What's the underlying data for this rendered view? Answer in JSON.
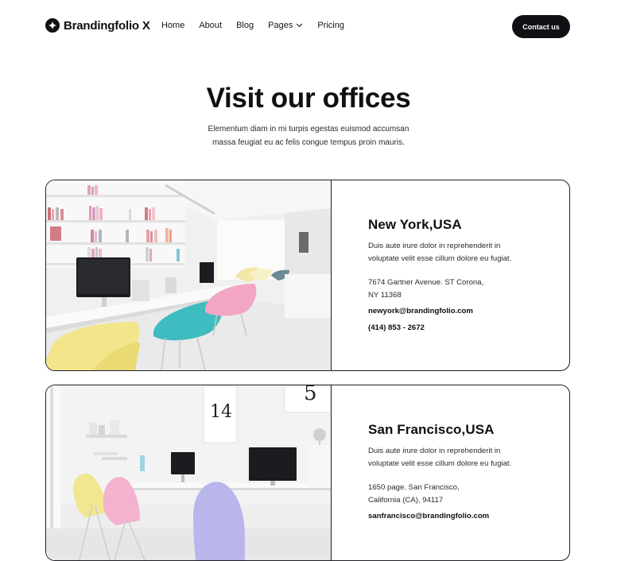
{
  "brand": {
    "name": "Brandingfolio X",
    "icon": "sparkle-icon"
  },
  "nav": {
    "items": [
      "Home",
      "About",
      "Blog",
      "Pages",
      "Pricing"
    ],
    "contact_label": "Contact us"
  },
  "hero": {
    "title": "Visit our offices",
    "subtitle_line1": "Elementum diam in mi turpis egestas euismod accumsan",
    "subtitle_line2": "massa feugiat eu ac felis congue tempus proin mauris."
  },
  "offices": [
    {
      "city": "New York,USA",
      "desc_line1": "Duis aute irure dolor in reprehenderit in",
      "desc_line2": "voluptate velit esse cillum dolore eu fugiat.",
      "addr_line1": "7674 Gartner Avenue. ST Corona,",
      "addr_line2": "NY 11368",
      "email": "newyork@brandingfolio.com",
      "phone": "(414) 853 - 2672"
    },
    {
      "city": "San Francisco,USA",
      "desc_line1": "Duis aute irure dolor in reprehenderit in",
      "desc_line2": "voluptate velit esse cillum dolore eu fugiat.",
      "addr_line1": "1650 page. San Francisco,",
      "addr_line2": "California (CA), 94117",
      "email": "sanfrancisco@brandingfolio.com",
      "phone": ""
    }
  ],
  "colors": {
    "ink": "#0f0f14",
    "chair_yellow": "#f2e58a",
    "chair_teal": "#3fbcc0",
    "chair_pink": "#f2a6c4",
    "chair_lilac": "#b9b6ec"
  }
}
